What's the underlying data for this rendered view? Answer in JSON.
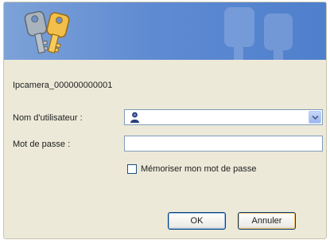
{
  "banner": {
    "icon": "keys-icon",
    "watermark": "keys-watermark-icon"
  },
  "device": {
    "name": "Ipcamera_000000000001"
  },
  "form": {
    "username_label": "Nom d'utilisateur :",
    "username_value": "",
    "username_icon": "user-icon",
    "password_label": "Mot de passe :",
    "password_value": "",
    "remember_label": "Mémoriser mon mot de passe",
    "remember_checked": false
  },
  "buttons": {
    "ok": "OK",
    "cancel": "Annuler"
  },
  "colors": {
    "banner": "#5f8bd2",
    "dialog_bg": "#ece9d8",
    "field_border": "#7f9db9",
    "button_border": "#003c74"
  }
}
